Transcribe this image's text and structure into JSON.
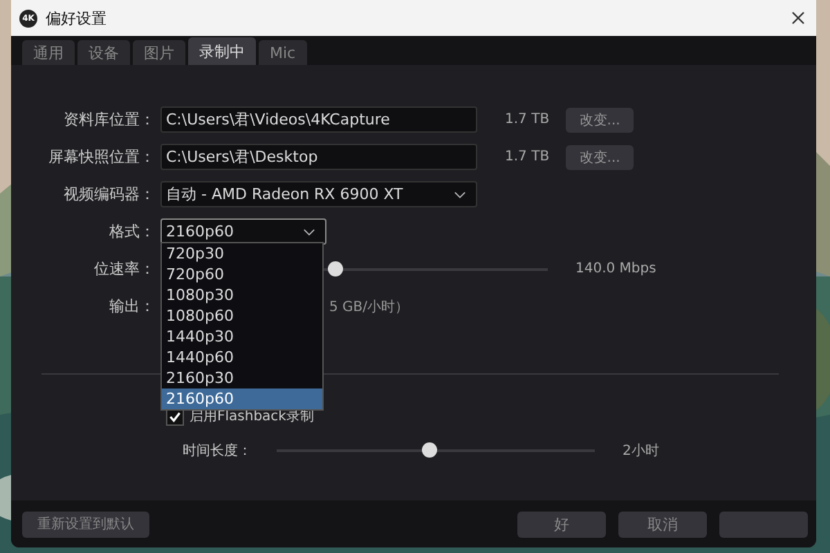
{
  "window": {
    "title": "偏好设置",
    "logo": "4K"
  },
  "tabs": [
    {
      "label": "通用",
      "selected": false
    },
    {
      "label": "设备",
      "selected": false
    },
    {
      "label": "图片",
      "selected": false
    },
    {
      "label": "录制中",
      "selected": true
    },
    {
      "label": "Mic",
      "selected": false
    }
  ],
  "locations": [
    {
      "label": "资料库位置：",
      "value": "C:\\Users\\君\\Videos\\4KCapture",
      "free": "1.7 TB",
      "button": "改变..."
    },
    {
      "label": "屏幕快照位置：",
      "value": "C:\\Users\\君\\Desktop",
      "free": "1.7 TB",
      "button": "改变..."
    }
  ],
  "encoder": {
    "label": "视频编码器：",
    "value": "自动 - AMD Radeon RX 6900 XT"
  },
  "format": {
    "label": "格式：",
    "value": "2160p60",
    "options": [
      {
        "label": "720p30",
        "selected": false
      },
      {
        "label": "720p60",
        "selected": false
      },
      {
        "label": "1080p30",
        "selected": false
      },
      {
        "label": "1080p60",
        "selected": false
      },
      {
        "label": "1440p30",
        "selected": false
      },
      {
        "label": "1440p60",
        "selected": false
      },
      {
        "label": "2160p30",
        "selected": false
      },
      {
        "label": "2160p60",
        "selected": true
      }
    ]
  },
  "bitrate": {
    "label": "位速率：",
    "level": 0.45,
    "reading": "140.0 Mbps"
  },
  "output": {
    "label": "输出：",
    "value": "5 GB/小时）"
  },
  "flashback": {
    "label": "启用Flashback录制",
    "checked": true
  },
  "duration": {
    "label": "时间长度：",
    "level": 0.48,
    "reading": "2小时"
  },
  "footer": {
    "reset": "重新设置到默认",
    "ok": "好",
    "cancel": "取消"
  }
}
